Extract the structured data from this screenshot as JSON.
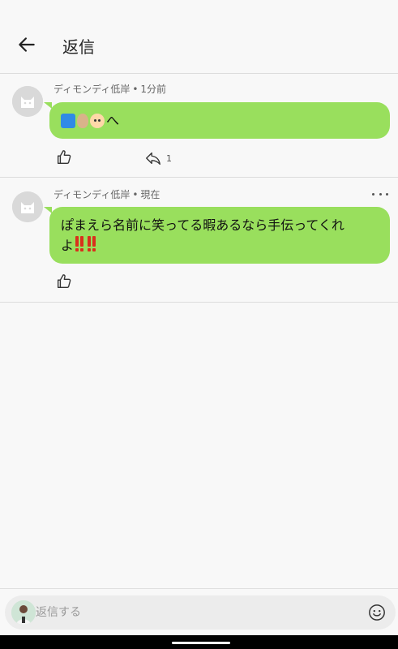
{
  "header": {
    "title": "返信",
    "back_icon": "arrow-left-icon"
  },
  "comments": [
    {
      "author": "ディモンディ低岸",
      "separator": "•",
      "time": "1分前",
      "emojis": [
        "blue-square",
        "egg",
        "baby-face"
      ],
      "text_suffix": "へ",
      "reply_count": "1"
    },
    {
      "author": "ディモンディ低岸",
      "separator": "•",
      "time": "現在",
      "text_line1": "ぽまえら名前に笑ってる暇あるなら手伝ってくれ",
      "text_line2": "よ",
      "emojis": [
        "double-exclamation",
        "double-exclamation"
      ]
    }
  ],
  "input": {
    "placeholder": "返信する",
    "value": ""
  },
  "colors": {
    "bubble": "#99df5d",
    "background": "#f8f8f8",
    "divider": "#dcdcdc"
  }
}
